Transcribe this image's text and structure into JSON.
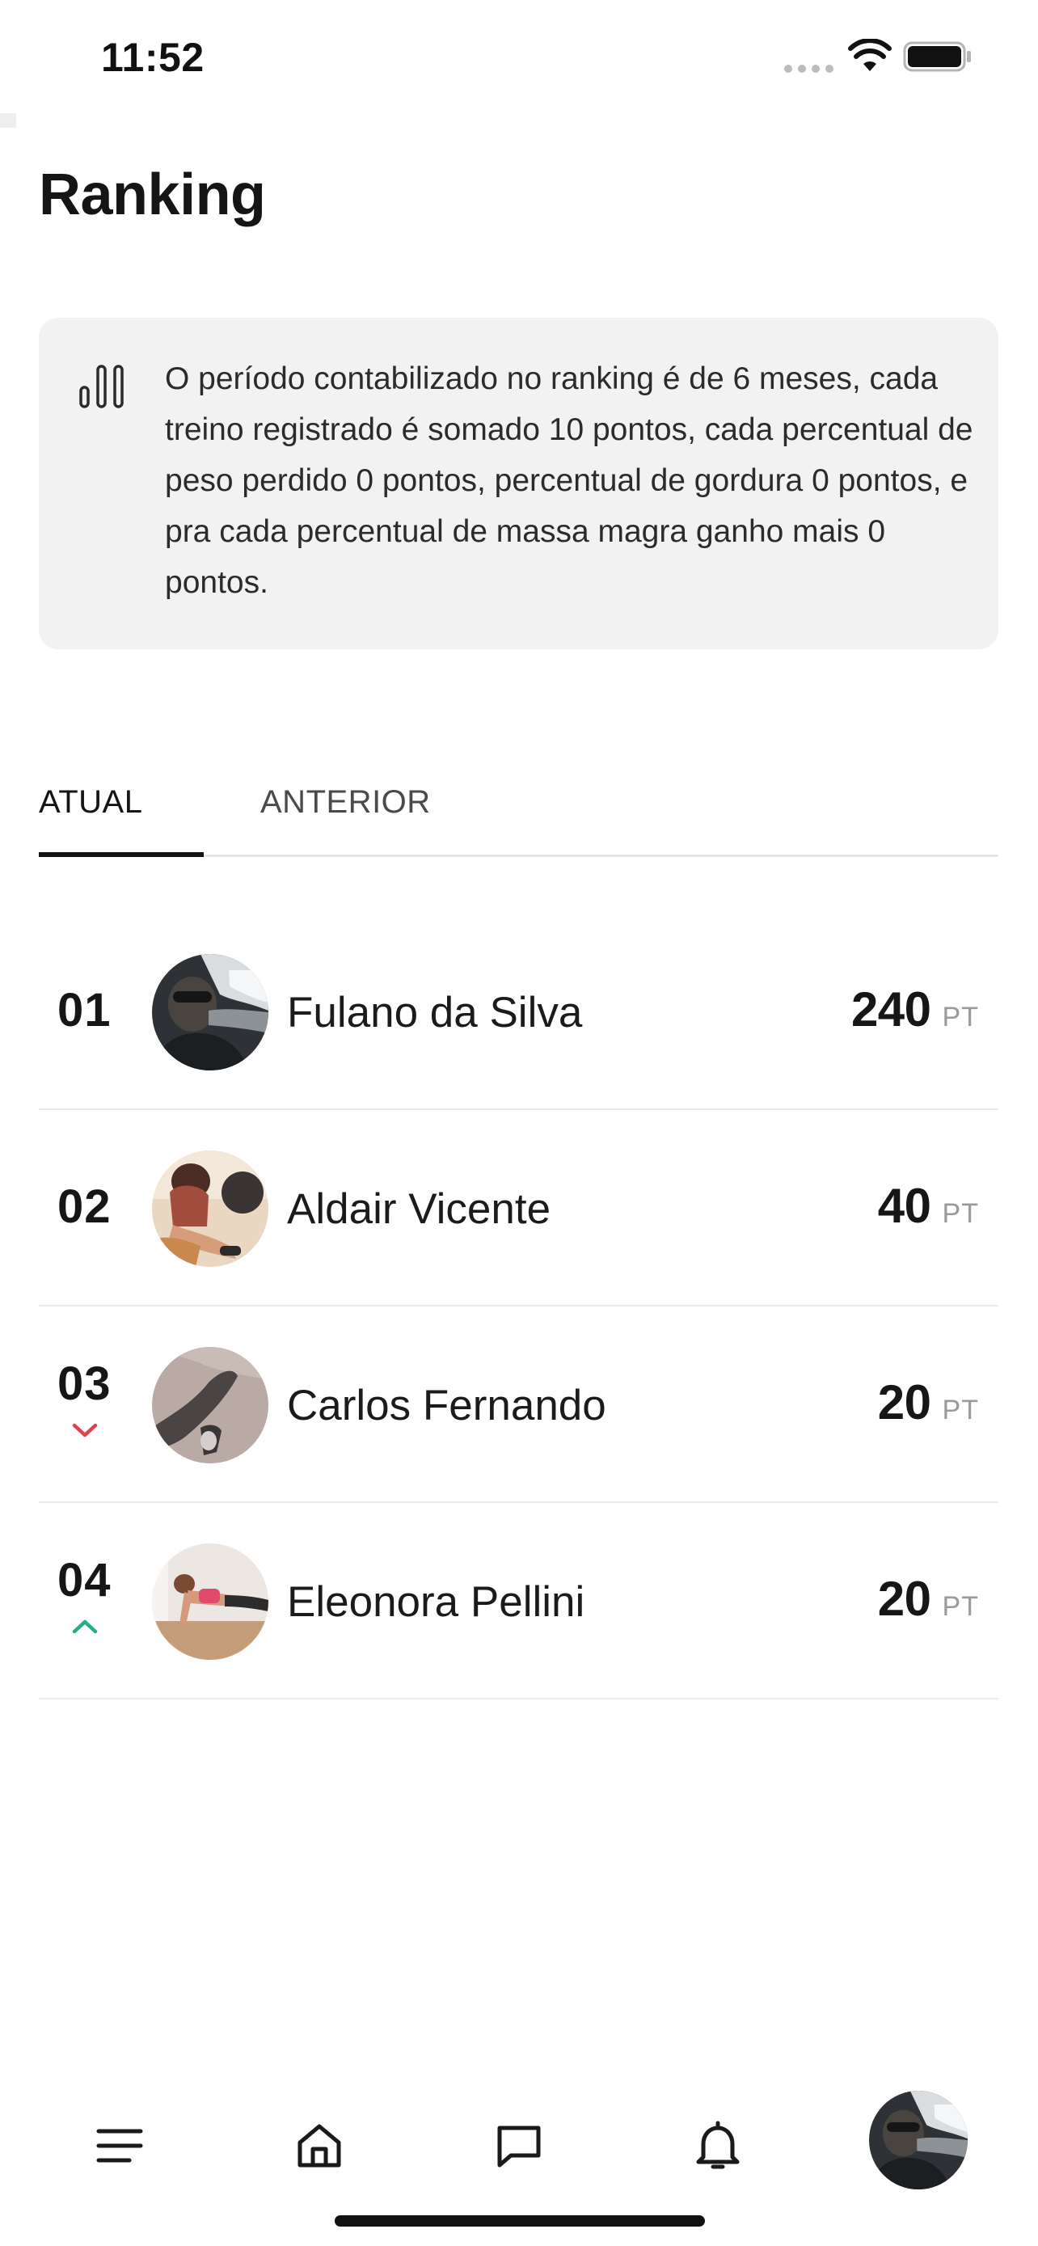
{
  "status_bar": {
    "time": "11:52",
    "icons": [
      "signal-icon",
      "wifi-icon",
      "battery-icon"
    ]
  },
  "page": {
    "title": "Ranking"
  },
  "info": {
    "icon": "bar-chart-icon",
    "text": "O período contabilizado no ranking é de 6 meses, cada treino registrado é somado 10 pontos, cada percentual de peso perdido 0 pontos, percentual de gordura 0 pontos, e pra cada percentual de massa magra ganho mais 0 pontos."
  },
  "tabs": [
    {
      "label": "ATUAL",
      "active": true
    },
    {
      "label": "ANTERIOR",
      "active": false
    }
  ],
  "ranking": [
    {
      "position": "01",
      "name": "Fulano da Silva",
      "points": "240",
      "unit": "PT",
      "trend": null
    },
    {
      "position": "02",
      "name": "Aldair Vicente",
      "points": "40",
      "unit": "PT",
      "trend": null
    },
    {
      "position": "03",
      "name": "Carlos Fernando",
      "points": "20",
      "unit": "PT",
      "trend": "down"
    },
    {
      "position": "04",
      "name": "Eleonora Pellini",
      "points": "20",
      "unit": "PT",
      "trend": "up"
    }
  ],
  "colors": {
    "trend_down": "#e0414a",
    "trend_up": "#22b07d",
    "info_bg": "#f2f2f2"
  },
  "bottom_nav": {
    "items": [
      "menu-icon",
      "home-icon",
      "chat-icon",
      "bell-icon",
      "profile-avatar"
    ]
  }
}
